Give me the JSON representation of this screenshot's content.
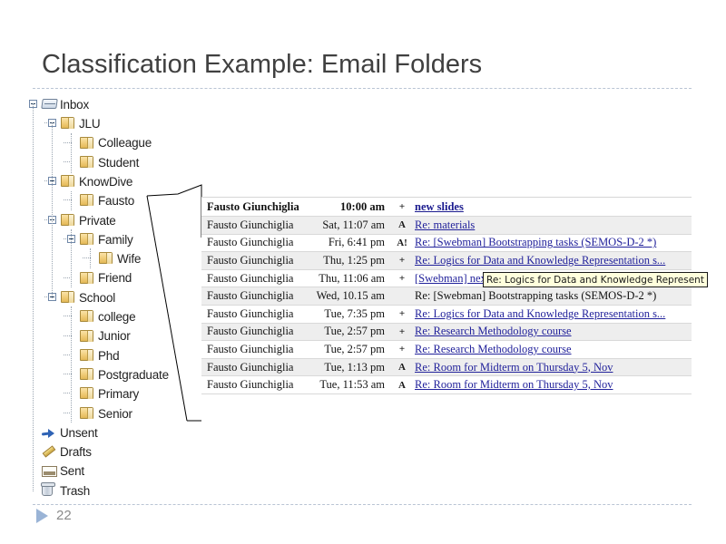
{
  "slide": {
    "title": "Classification Example: Email Folders",
    "page_number": "22",
    "marker_icon": "play-triangle-icon"
  },
  "tree": {
    "nodes": [
      {
        "label": "Inbox",
        "depth": 0,
        "icon": "inbox-tray-icon",
        "expander": "minus"
      },
      {
        "label": "JLU",
        "depth": 1,
        "icon": "folder-icon",
        "expander": "minus"
      },
      {
        "label": "Colleague",
        "depth": 2,
        "icon": "folder-icon",
        "expander": "none"
      },
      {
        "label": "Student",
        "depth": 2,
        "icon": "folder-icon",
        "expander": "none"
      },
      {
        "label": "KnowDive",
        "depth": 1,
        "icon": "folder-icon",
        "expander": "minus"
      },
      {
        "label": "Fausto",
        "depth": 2,
        "icon": "folder-icon",
        "expander": "none"
      },
      {
        "label": "Private",
        "depth": 1,
        "icon": "folder-icon",
        "expander": "minus"
      },
      {
        "label": "Family",
        "depth": 2,
        "icon": "folder-icon",
        "expander": "minus"
      },
      {
        "label": "Wife",
        "depth": 3,
        "icon": "folder-icon",
        "expander": "none"
      },
      {
        "label": "Friend",
        "depth": 2,
        "icon": "folder-icon",
        "expander": "none"
      },
      {
        "label": "School",
        "depth": 1,
        "icon": "folder-icon",
        "expander": "minus"
      },
      {
        "label": "college",
        "depth": 2,
        "icon": "folder-icon",
        "expander": "none"
      },
      {
        "label": "Junior",
        "depth": 2,
        "icon": "folder-icon",
        "expander": "none"
      },
      {
        "label": "Phd",
        "depth": 2,
        "icon": "folder-icon",
        "expander": "none"
      },
      {
        "label": "Postgraduate",
        "depth": 2,
        "icon": "folder-icon",
        "expander": "none"
      },
      {
        "label": "Primary",
        "depth": 2,
        "icon": "folder-icon",
        "expander": "none"
      },
      {
        "label": "Senior",
        "depth": 2,
        "icon": "folder-icon",
        "expander": "none"
      },
      {
        "label": "Unsent",
        "depth": 0,
        "icon": "arrow-icon",
        "expander": "none"
      },
      {
        "label": "Drafts",
        "depth": 0,
        "icon": "pencil-icon",
        "expander": "none"
      },
      {
        "label": "Sent",
        "depth": 0,
        "icon": "envelope-icon",
        "expander": "none"
      },
      {
        "label": "Trash",
        "depth": 0,
        "icon": "trash-icon",
        "expander": "none"
      }
    ]
  },
  "mail_list": {
    "tooltip": "Re: Logics for Data and Knowledge Represent",
    "rows": [
      {
        "sender": "Fausto Giunchiglia",
        "date": "10:00 am",
        "flag": "+",
        "subject": "new slides",
        "link": true
      },
      {
        "sender": "Fausto Giunchiglia",
        "date": "Sat, 11:07 am",
        "flag": "A",
        "subject": "Re: materials",
        "link": true
      },
      {
        "sender": "Fausto Giunchiglia",
        "date": "Fri, 6:41 pm",
        "flag": "A!",
        "subject": "Re: [Swebman] Bootstrapping tasks (SEMOS-D-2 *)",
        "link": true
      },
      {
        "sender": "Fausto Giunchiglia",
        "date": "Thu, 1:25 pm",
        "flag": "+",
        "subject": "Re: Logics for Data and Knowledge Representation s...",
        "link": true
      },
      {
        "sender": "Fausto Giunchiglia",
        "date": "Thu, 11:06 am",
        "flag": "+",
        "subject": "[Swebman] next",
        "link": true
      },
      {
        "sender": "Fausto Giunchiglia",
        "date": "Wed, 10.15 am",
        "flag": "",
        "subject": "Re: [Swebman] Bootstrapping tasks (SEMOS-D-2 *)",
        "link": false
      },
      {
        "sender": "Fausto Giunchiglia",
        "date": "Tue, 7:35 pm",
        "flag": "+",
        "subject": "Re: Logics for Data and Knowledge Representation s...",
        "link": true
      },
      {
        "sender": "Fausto Giunchiglia",
        "date": "Tue, 2:57 pm",
        "flag": "+",
        "subject": "Re: Research Methodology course",
        "link": true
      },
      {
        "sender": "Fausto Giunchiglia",
        "date": "Tue, 2:57 pm",
        "flag": "+",
        "subject": "Re: Research Methodology course",
        "link": true
      },
      {
        "sender": "Fausto Giunchiglia",
        "date": "Tue, 1:13 pm",
        "flag": "A",
        "subject": "Re: Room for Midterm on Thursday 5, Nov",
        "link": true
      },
      {
        "sender": "Fausto Giunchiglia",
        "date": "Tue, 11:53 am",
        "flag": "A",
        "subject": "Re: Room for Midterm on Thursday 5, Nov",
        "link": true
      }
    ]
  },
  "colors": {
    "title": "#404040",
    "link": "#22229b",
    "row_alt": "#eeeeee",
    "tooltip_bg": "#ffffdc",
    "rule": "#b9c4d4",
    "marker": "#9ab4d6"
  }
}
